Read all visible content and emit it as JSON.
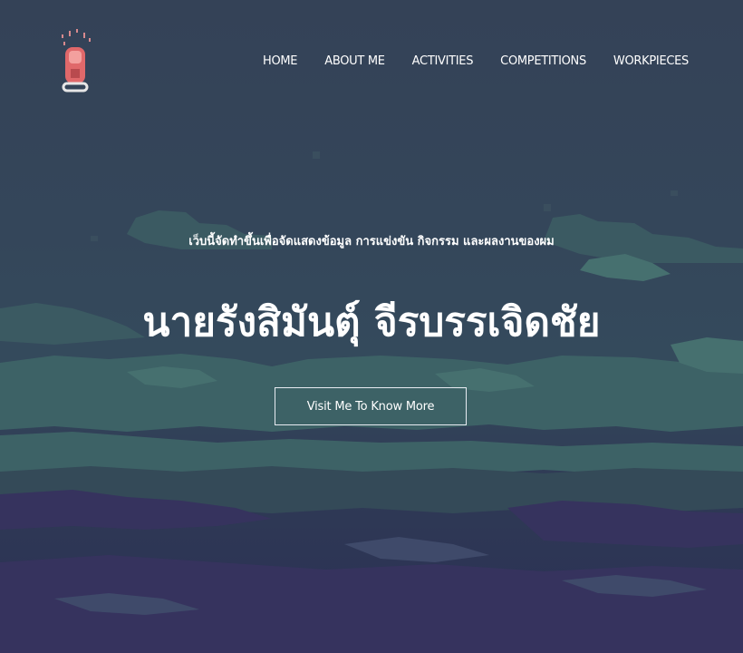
{
  "nav": {
    "logo_icon": "pixel-rocket-icon",
    "items": [
      {
        "label": "HOME"
      },
      {
        "label": "ABOUT ME"
      },
      {
        "label": "ACTIVITIES"
      },
      {
        "label": "COMPETITIONS"
      },
      {
        "label": "WORKPIECES"
      }
    ]
  },
  "hero": {
    "subtitle": "เว็บนี้จัดทำขึ้นเพื่อจัดแสดงข้อมูล การแข่งขัน กิจกรรม และผลงานของผม",
    "title": "นายรังสิมันต์ุ จีรบรรเจิดชัย",
    "cta_label": "Visit Me To Know More"
  },
  "colors": {
    "sky_top": "#344257",
    "cloud_teal": "#3e6468",
    "cloud_dark_teal": "#355458",
    "cloud_purple": "#34305a",
    "logo_red": "#e0686a",
    "text": "#ffffff"
  }
}
